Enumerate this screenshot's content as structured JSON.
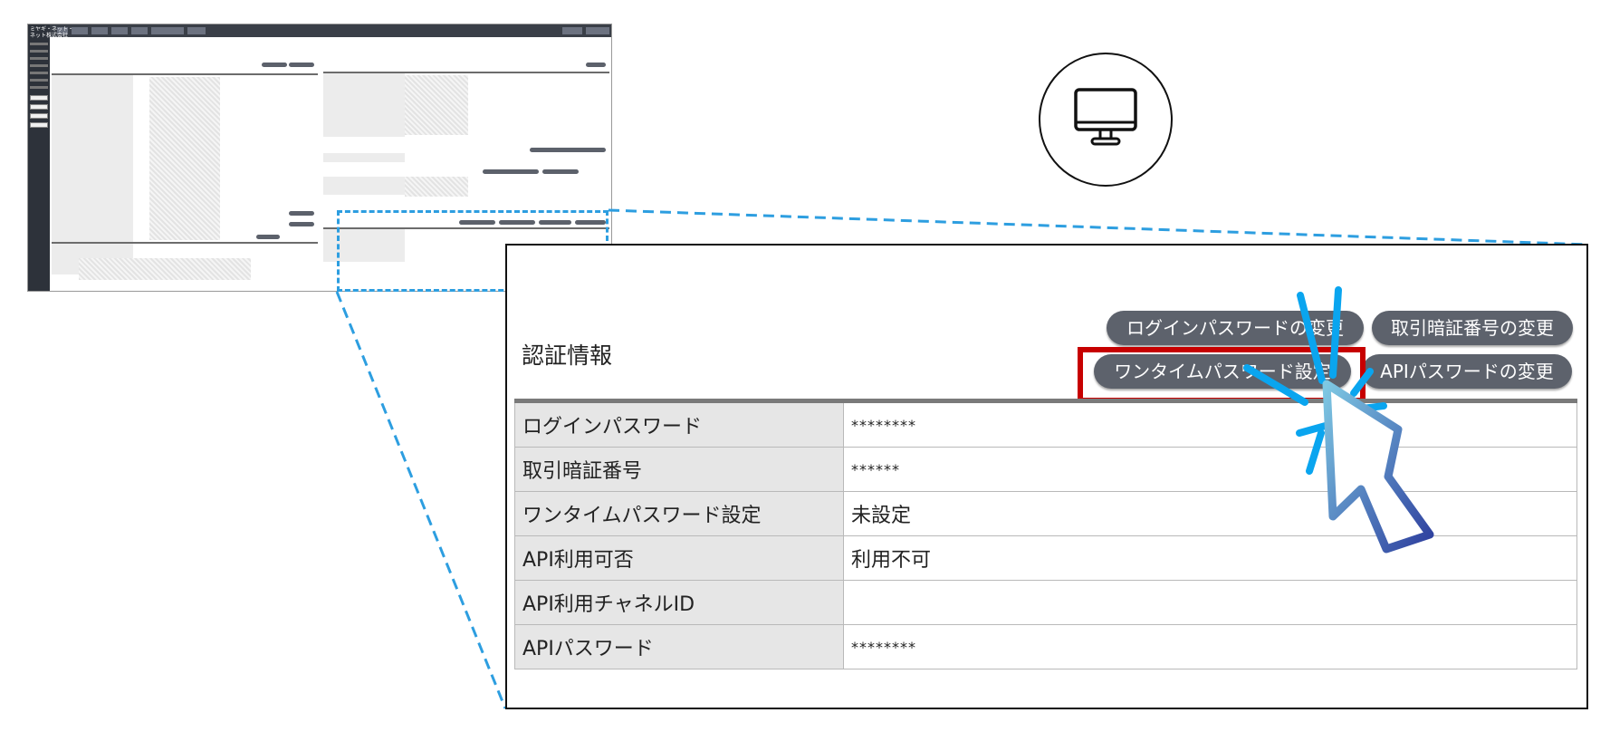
{
  "thumbnail": {
    "logo_line1": "ミヤギ・ネット・",
    "logo_line2": "ネット株式会社"
  },
  "auth_section": {
    "title": "認証情報",
    "buttons": {
      "change_login_password": "ログインパスワードの変更",
      "change_transaction_pin": "取引暗証番号の変更",
      "onetime_password_setting": "ワンタイムパスワード設定",
      "change_api_password": "APIパスワードの変更"
    },
    "rows": [
      {
        "label": "ログインパスワード",
        "value": "********"
      },
      {
        "label": "取引暗証番号",
        "value": "******"
      },
      {
        "label": "ワンタイムパスワード設定",
        "value": "未設定"
      },
      {
        "label": "API利用可否",
        "value": "利用不可"
      },
      {
        "label": "API利用チャネルID",
        "value": ""
      },
      {
        "label": "APIパスワード",
        "value": "********"
      }
    ]
  },
  "colors": {
    "highlight_dashed": "#2d9ee0",
    "emphasis_frame": "#c70000",
    "button_bg": "#5d626c",
    "table_label_bg": "#e6e6e6",
    "cursor_gradient_start": "#7ec8e3",
    "cursor_gradient_end": "#2e3f9e"
  },
  "icons": [
    "monitor-icon",
    "cursor-pointer-icon"
  ]
}
